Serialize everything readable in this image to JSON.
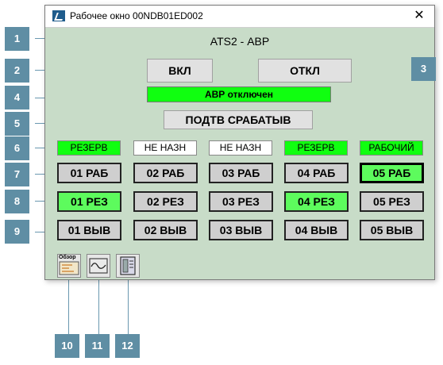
{
  "window": {
    "title": "Рабочее окно 00NDB01ED002",
    "close_glyph": "✕"
  },
  "header": {
    "title": "ATS2 - АВР"
  },
  "buttons": {
    "on": "ВКЛ",
    "off": "ОТКЛ",
    "confirm": "ПОДТВ СРАБАТЫВ"
  },
  "status": {
    "text": "АВР отключен",
    "color": "#10ff10"
  },
  "inputs": [
    {
      "label": "РЕЗЕРВ",
      "state": "green"
    },
    {
      "label": "НЕ НАЗН",
      "state": "white"
    },
    {
      "label": "НЕ НАЗН",
      "state": "white"
    },
    {
      "label": "РЕЗЕРВ",
      "state": "green"
    },
    {
      "label": "РАБОЧИЙ",
      "state": "green"
    }
  ],
  "rows": {
    "rab": [
      "01 РАБ",
      "02 РАБ",
      "03 РАБ",
      "04 РАБ",
      "05 РАБ"
    ],
    "rez": [
      "01 РЕЗ",
      "02 РЕЗ",
      "03 РЕЗ",
      "04 РЕЗ",
      "05 РЕЗ"
    ],
    "vyv": [
      "01 ВЫВ",
      "02 ВЫВ",
      "03 ВЫВ",
      "04 ВЫВ",
      "05 ВЫВ"
    ]
  },
  "toolbar": {
    "overview_label": "Обзор"
  },
  "callouts": [
    "1",
    "2",
    "3",
    "4",
    "5",
    "6",
    "7",
    "8",
    "9",
    "10",
    "11",
    "12"
  ],
  "colors": {
    "panel_bg": "#c8dcc8",
    "active_green": "#10ff10",
    "light_green": "#5dfb5d",
    "callout": "#5f8ea4"
  }
}
